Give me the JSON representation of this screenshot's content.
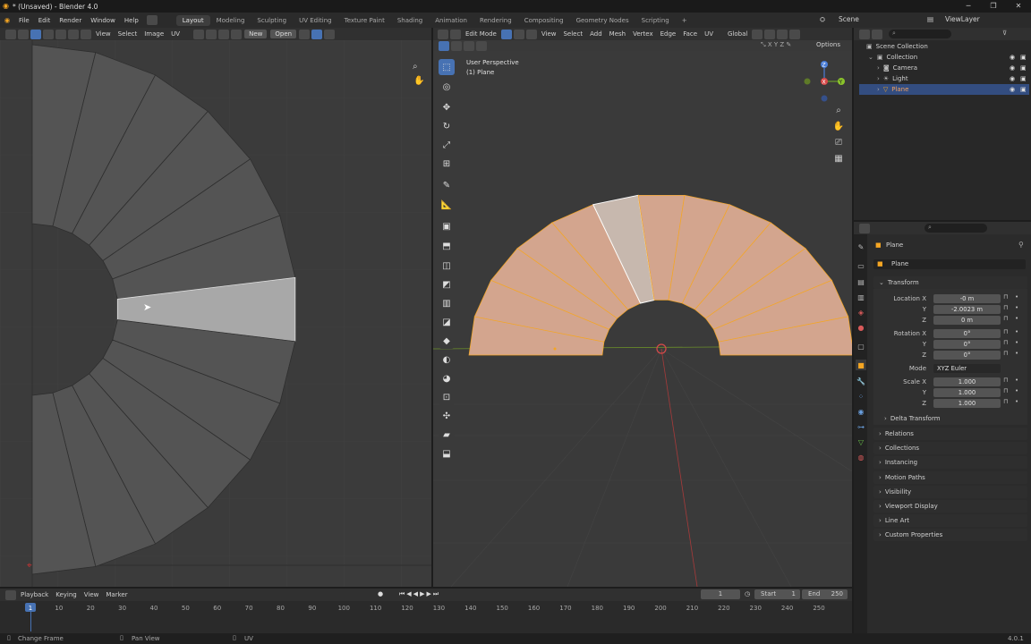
{
  "window": {
    "title": "* (Unsaved) - Blender 4.0"
  },
  "menu": [
    "File",
    "Edit",
    "Render",
    "Window",
    "Help"
  ],
  "workspaces": [
    "Layout",
    "Modeling",
    "Sculpting",
    "UV Editing",
    "Texture Paint",
    "Shading",
    "Animation",
    "Rendering",
    "Compositing",
    "Geometry Nodes",
    "Scripting"
  ],
  "active_workspace": "Layout",
  "scene": {
    "label": "Scene",
    "viewlayer": "ViewLayer"
  },
  "uv_editor": {
    "menus": [
      "View",
      "Select",
      "Image",
      "UV"
    ],
    "new_label": "New",
    "open_label": "Open"
  },
  "viewport": {
    "mode": "Edit Mode",
    "menus": [
      "View",
      "Select",
      "Add",
      "Mesh",
      "Vertex",
      "Edge",
      "Face",
      "UV"
    ],
    "orientation": "Global",
    "options": "Options",
    "overlay_title": "User Perspective",
    "overlay_sub": "(1) Plane",
    "axis_x": "X",
    "axis_y": "Y",
    "axis_z": "Z"
  },
  "outliner": {
    "root": "Scene Collection",
    "items": [
      {
        "label": "Collection",
        "color": "#d0d0d0",
        "icon": "collection-icon"
      },
      {
        "label": "Camera",
        "color": "#d0d0d0",
        "icon": "camera-icon"
      },
      {
        "label": "Light",
        "color": "#d0d0d0",
        "icon": "light-icon"
      },
      {
        "label": "Plane",
        "color": "#f0a060",
        "icon": "mesh-icon"
      }
    ]
  },
  "properties": {
    "object_name": "Plane",
    "datablock": "Plane",
    "transform_title": "Transform",
    "location": {
      "label": "Location X",
      "x": "-0 m",
      "y": "-2.0023 m",
      "z": "0 m"
    },
    "rotation": {
      "label": "Rotation X",
      "x": "0°",
      "y": "0°",
      "z": "0°"
    },
    "mode": {
      "label": "Mode",
      "value": "XYZ Euler"
    },
    "scale": {
      "label": "Scale X",
      "x": "1.000",
      "y": "1.000",
      "z": "1.000"
    },
    "axis_y": "Y",
    "axis_z": "Z",
    "delta": "Delta Transform",
    "panels": [
      "Relations",
      "Collections",
      "Instancing",
      "Motion Paths",
      "Visibility",
      "Viewport Display",
      "Line Art",
      "Custom Properties"
    ]
  },
  "timeline": {
    "menus": [
      "Playback",
      "Keying",
      "View",
      "Marker"
    ],
    "current": "1",
    "start_label": "Start",
    "start": "1",
    "end_label": "End",
    "end": "250",
    "ticks": [
      "1",
      "10",
      "20",
      "30",
      "40",
      "50",
      "60",
      "70",
      "80",
      "90",
      "100",
      "110",
      "120",
      "130",
      "140",
      "150",
      "160",
      "170",
      "180",
      "190",
      "200",
      "210",
      "220",
      "230",
      "240",
      "250"
    ]
  },
  "status": {
    "left": "Change Frame",
    "mid": "Pan View",
    "right": "UV",
    "version": "4.0.1"
  },
  "colors": {
    "selected_face": "#c7b8ae",
    "face": "#d3a58e",
    "edge": "#f5a623",
    "accent": "#4772b3"
  }
}
